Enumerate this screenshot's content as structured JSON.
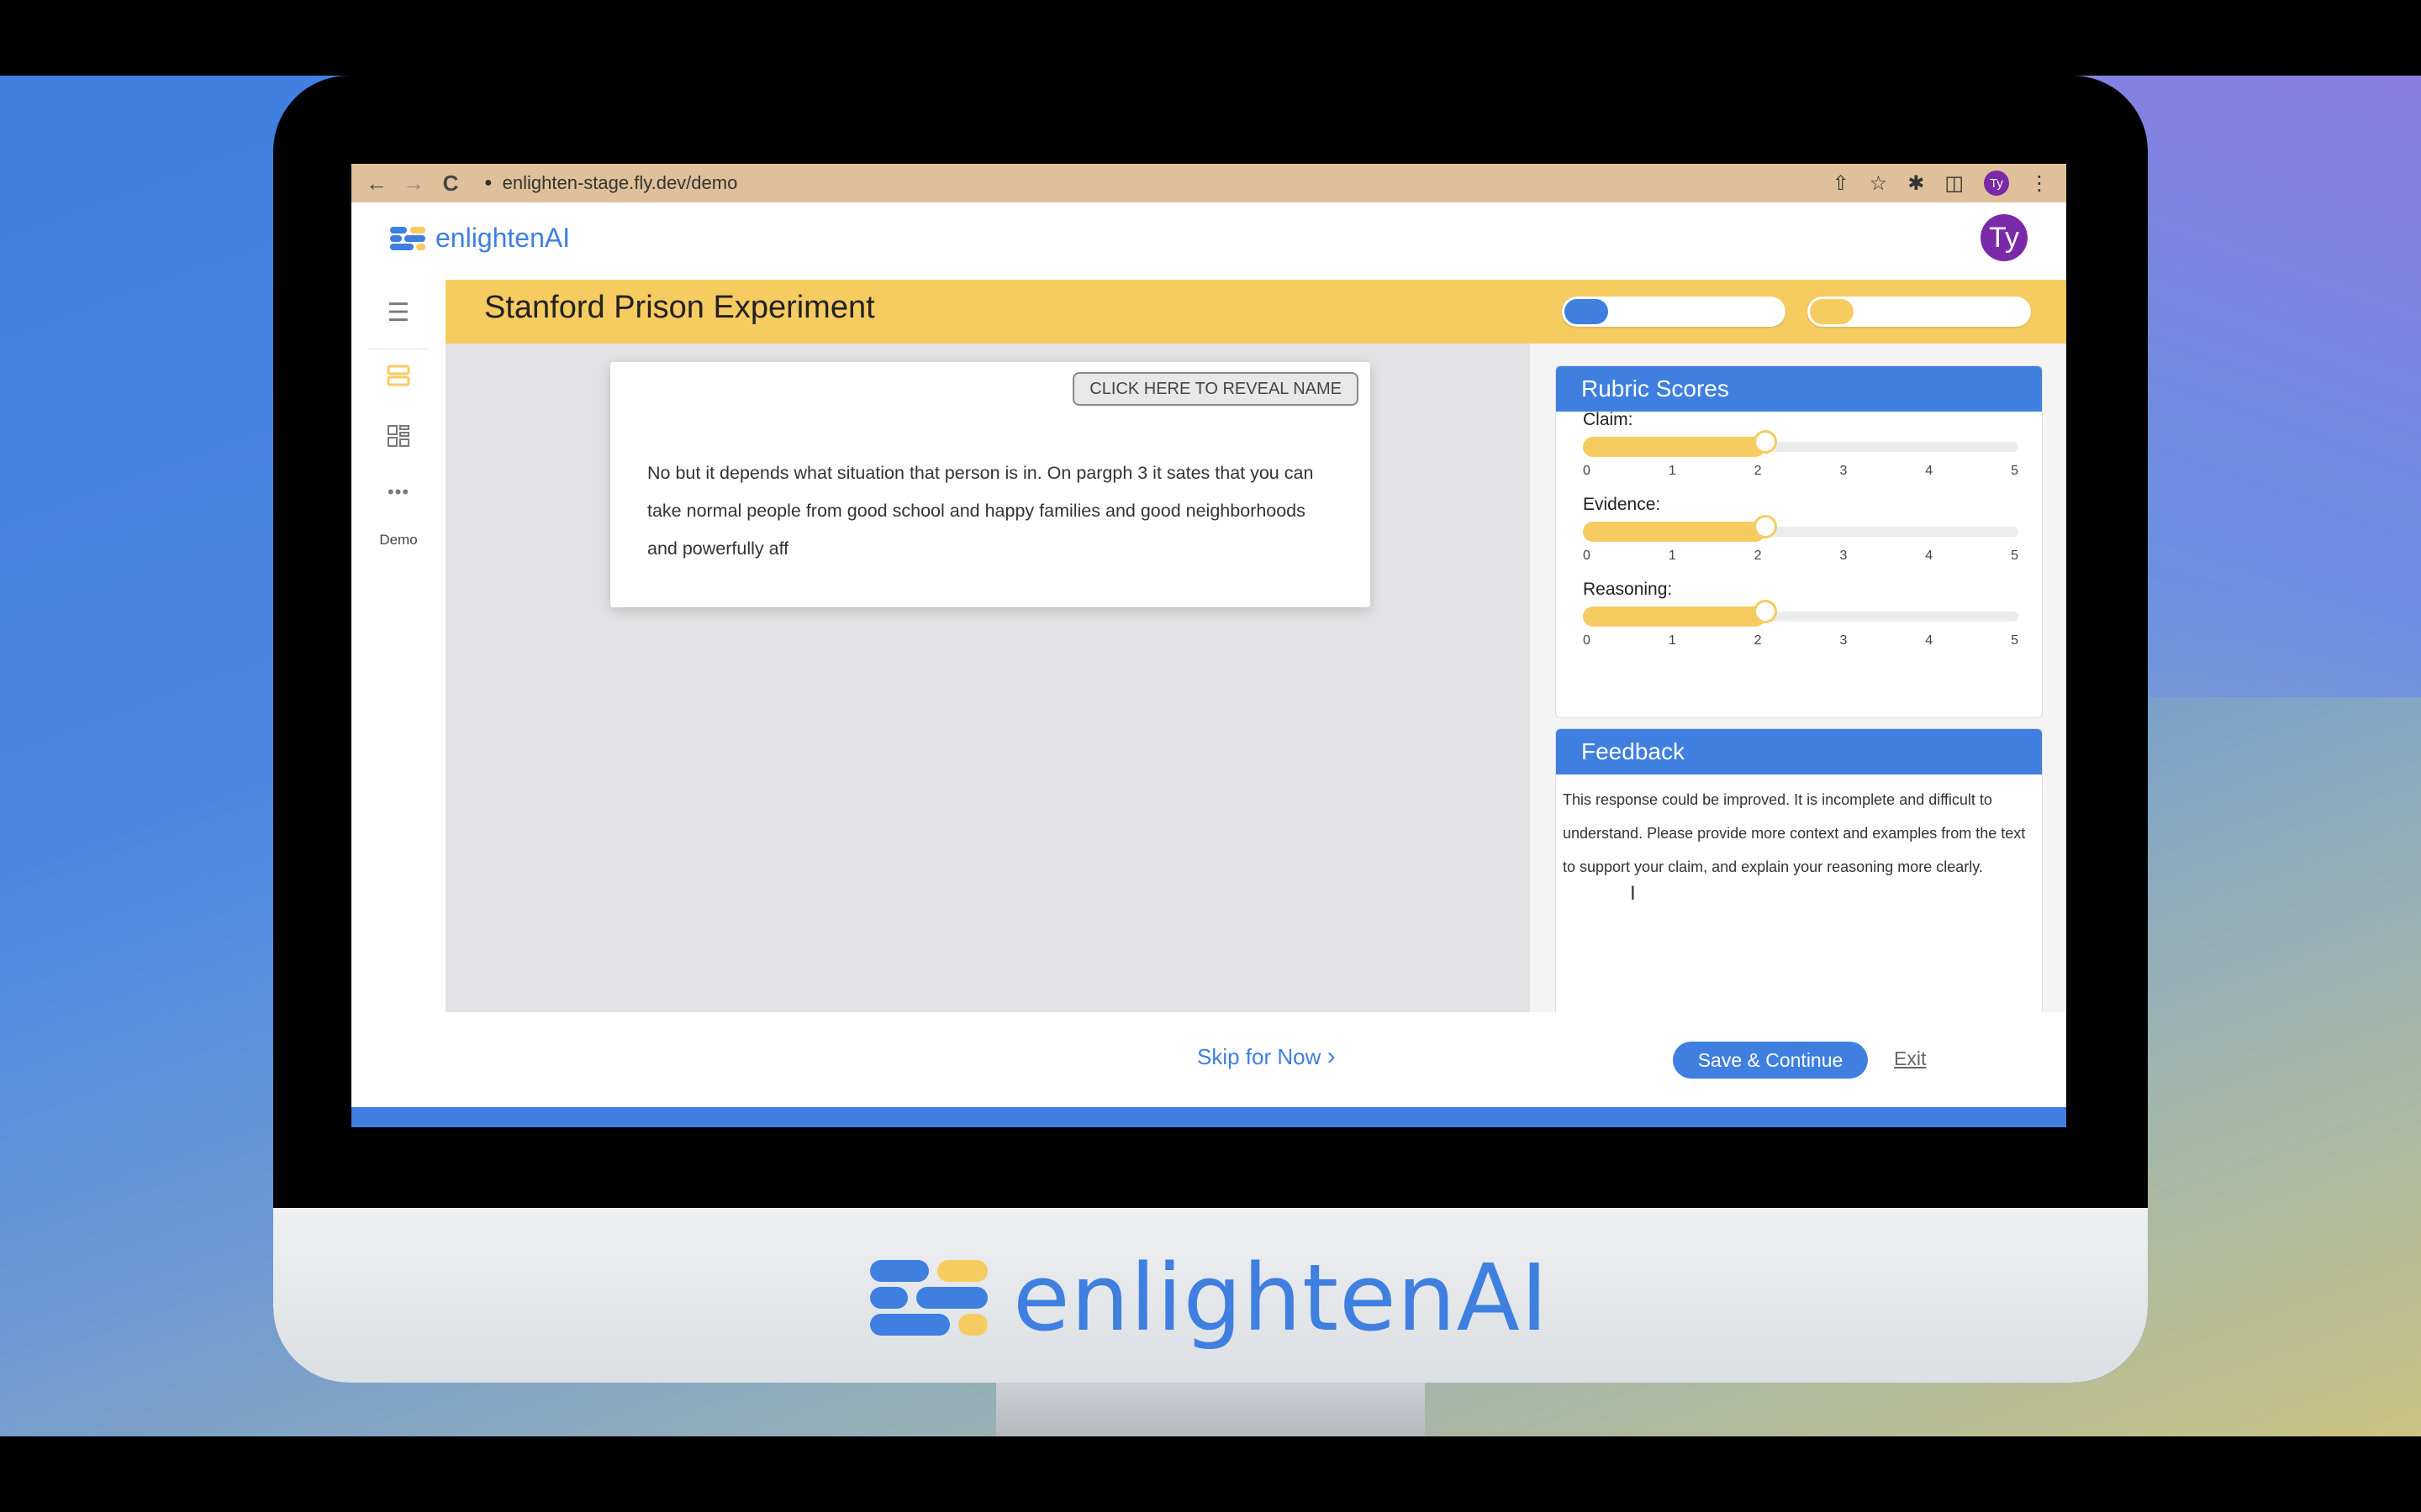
{
  "browser": {
    "url": "enlighten-stage.fly.dev/demo",
    "back_icon": "←",
    "forward_icon": "→",
    "reload_icon": "C",
    "profile_initials": "Ty"
  },
  "app": {
    "brand_name": "enlightenAI",
    "user_initials": "Ty"
  },
  "sidebar": {
    "items": [
      {
        "name": "menu-icon"
      },
      {
        "name": "rows-icon"
      },
      {
        "name": "grid-icon"
      },
      {
        "name": "more-icon"
      }
    ],
    "demo_label": "Demo"
  },
  "assignment": {
    "title": "Stanford Prison Experiment",
    "progress": [
      {
        "fraction": 0.2,
        "color": "#3f7fe0"
      },
      {
        "fraction": 0.2,
        "color": "#f6cb60"
      }
    ]
  },
  "response": {
    "reveal_label": "CLICK HERE TO REVEAL NAME",
    "text": "No but it depends what situation that person is in. On pargph 3 it sates that you can take normal people from good school and happy families and good neighborhoods and powerfully aff"
  },
  "rubric": {
    "title": "Rubric Scores",
    "scale_max": 5,
    "ticks": [
      "0",
      "1",
      "2",
      "3",
      "4",
      "5"
    ],
    "criteria": [
      {
        "label": "Claim:",
        "score": 2
      },
      {
        "label": "Evidence:",
        "score": 2
      },
      {
        "label": "Reasoning:",
        "score": 2
      }
    ]
  },
  "feedback": {
    "title": "Feedback",
    "text": "This response could be improved. It is incomplete and difficult to understand. Please provide more context and examples from the text to support your claim, and explain your reasoning more clearly."
  },
  "footer": {
    "skip_label": "Skip for Now",
    "skip_icon": "›",
    "save_label": "Save & Continue",
    "exit_label": "Exit"
  },
  "monitor": {
    "brand_name": "enlightenAI"
  },
  "colors": {
    "brand_blue": "#3f7fe0",
    "brand_yellow": "#f6cb60",
    "avatar_purple": "#7a2aa8"
  }
}
